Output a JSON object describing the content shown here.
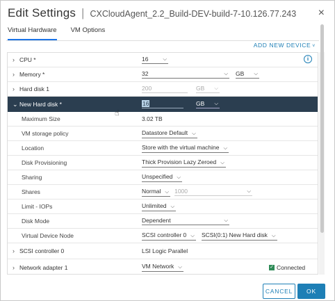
{
  "dialog": {
    "title": "Edit Settings",
    "separator": "|",
    "vm_name": "CXCloudAgent_2.2_Build-DEV-build-7-10.126.77.243",
    "close_icon": "×"
  },
  "tabs": [
    {
      "label": "Virtual Hardware",
      "active": true
    },
    {
      "label": "VM Options",
      "active": false
    }
  ],
  "add_device": {
    "label": "ADD NEW DEVICE",
    "caret": "˅"
  },
  "rows": {
    "cpu": {
      "label": "CPU *",
      "value": "16"
    },
    "memory": {
      "label": "Memory *",
      "value": "32",
      "unit": "GB"
    },
    "hard_disk_1": {
      "label": "Hard disk 1",
      "value": "200",
      "unit": "GB"
    },
    "new_hard_disk": {
      "label": "New Hard disk *",
      "value": "16",
      "unit": "GB"
    },
    "max_size": {
      "label": "Maximum Size",
      "value": "3.02 TB"
    },
    "storage_policy": {
      "label": "VM storage policy",
      "value": "Datastore Default"
    },
    "location": {
      "label": "Location",
      "value": "Store with the virtual machine"
    },
    "disk_provisioning": {
      "label": "Disk Provisioning",
      "value": "Thick Provision Lazy Zeroed"
    },
    "sharing": {
      "label": "Sharing",
      "value": "Unspecified"
    },
    "shares": {
      "label": "Shares",
      "value": "Normal",
      "amount": "1000"
    },
    "limit_iops": {
      "label": "Limit - IOPs",
      "value": "Unlimited"
    },
    "disk_mode": {
      "label": "Disk Mode",
      "value": "Dependent"
    },
    "virtual_device_node": {
      "label": "Virtual Device Node",
      "controller": "SCSI controller 0",
      "node": "SCSI(0:1) New Hard disk"
    },
    "scsi_controller": {
      "label": "SCSI controller 0",
      "value": "LSI Logic Parallel"
    },
    "network_adapter": {
      "label": "Network adapter 1",
      "value": "VM Network",
      "connected_label": "Connected",
      "connected": true
    }
  },
  "buttons": {
    "cancel": "CANCEL",
    "ok": "OK"
  },
  "colors": {
    "accent": "#1e7fb6",
    "selected_row": "#2b3e50",
    "connected_check": "#2e8b57"
  }
}
